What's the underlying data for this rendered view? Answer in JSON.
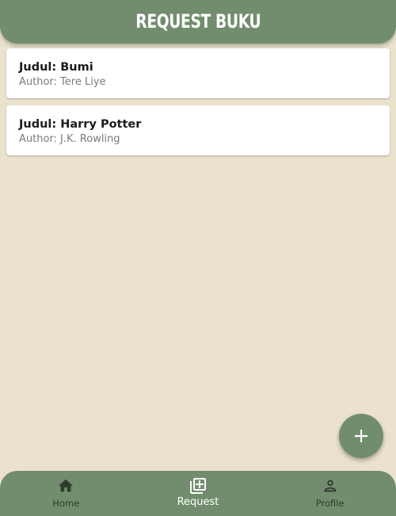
{
  "app_bar": {
    "title": "REQUEST BUKU"
  },
  "requests": [
    {
      "title": "Judul: Bumi",
      "author": "Author: Tere Liye"
    },
    {
      "title": "Judul: Harry Potter",
      "author": "Author: J.K. Rowling"
    }
  ],
  "fab": {
    "icon": "plus-icon"
  },
  "bottom_nav": {
    "items": [
      {
        "label": "Home",
        "icon": "home-icon",
        "active": false
      },
      {
        "label": "Request",
        "icon": "library-add-icon",
        "active": true
      },
      {
        "label": "Profile",
        "icon": "person-icon",
        "active": false
      }
    ]
  },
  "colors": {
    "primary": "#728d6e",
    "background": "#ebe2cd",
    "card": "#ffffff",
    "nav_inactive": "#303a2e",
    "nav_active": "#ffffff"
  }
}
